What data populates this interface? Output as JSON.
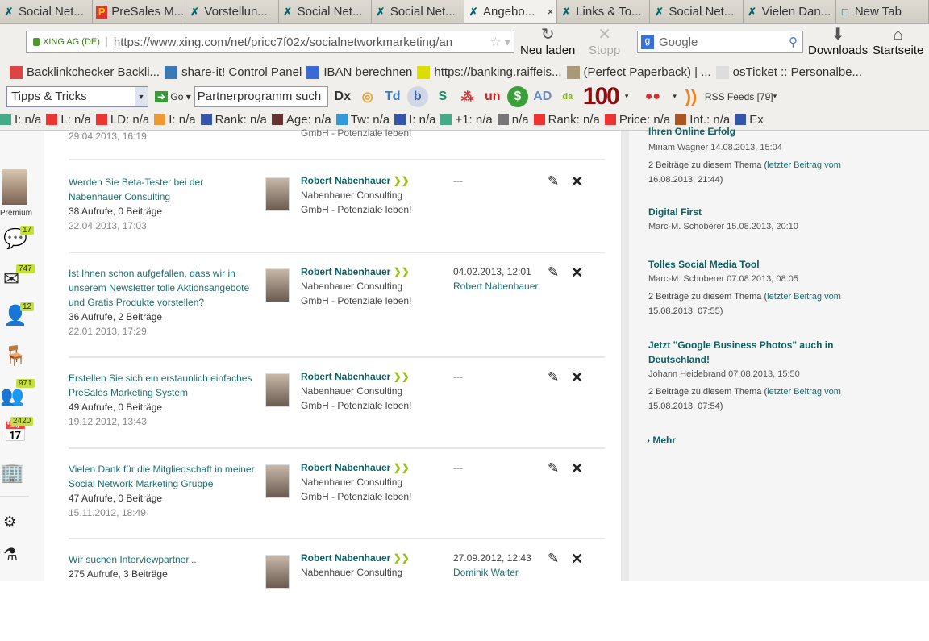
{
  "tabs": [
    {
      "label": "Social Net...",
      "icon": "xing-icon"
    },
    {
      "label": "PreSales M...",
      "icon": "presales-icon"
    },
    {
      "label": "Vorstellun...",
      "icon": "xing-icon"
    },
    {
      "label": "Social Net...",
      "icon": "xing-icon"
    },
    {
      "label": "Social Net...",
      "icon": "xing-icon"
    },
    {
      "label": "Angebo...",
      "icon": "xing-icon",
      "active": true
    },
    {
      "label": "Links & To...",
      "icon": "xing-icon"
    },
    {
      "label": "Social Net...",
      "icon": "xing-icon"
    },
    {
      "label": "Vielen Dan...",
      "icon": "xing-icon"
    },
    {
      "label": "New Tab",
      "icon": "blank-icon"
    }
  ],
  "nav": {
    "site_identity": "XING AG (DE)",
    "url": "https://www.xing.com/net/pricc7f02x/socialnetworkmarketing/an",
    "reload": "Neu laden",
    "stop": "Stopp",
    "search_placeholder": "Google",
    "downloads": "Downloads",
    "home": "Startseite"
  },
  "bookmarks": [
    "Backlinkchecker Backli...",
    "share-it! Control Panel",
    "IBAN berechnen",
    "https://banking.raiffeis...",
    "(Perfect Paperback) | ...",
    "osTicket :: Personalbe..."
  ],
  "toolbar": {
    "dropdown": "Tipps & Tricks",
    "go": "Go",
    "search_value": "Partnerprogramm such",
    "rss": "RSS Feeds [79]",
    "hundred": "100"
  },
  "seo": [
    "I: n/a",
    "L: n/a",
    "LD: n/a",
    "I: n/a",
    "Rank: n/a",
    "Age: n/a",
    "Tw: n/a",
    "I: n/a",
    "+1: n/a",
    "n/a",
    "Rank: n/a",
    "Price: n/a",
    "Int.: n/a",
    "Ex"
  ],
  "sidebar": {
    "premium": "Premium",
    "badges": {
      "messages_star": "17",
      "mail": "747",
      "contacts": "12",
      "groups": "971",
      "events": "2420"
    }
  },
  "main": {
    "top_partial": {
      "date": "29.04.2013, 16:19",
      "company": "GmbH - Potenziale leben!"
    },
    "rows": [
      {
        "title": "Werden Sie Beta-Tester bei der Nabenhauer Consulting",
        "stats": "38 Aufrufe, 0 Beiträge",
        "date": "22.04.2013, 17:03",
        "author": "Robert Nabenhauer",
        "company1": "Nabenhauer Consulting",
        "company2": "GmbH - Potenziale leben!",
        "last_date": "---",
        "last_author": ""
      },
      {
        "title": "Ist Ihnen schon aufgefallen, dass wir in unserem Newsletter tolle Aktionsangebote und Gratis Produkte vorstellen?",
        "stats": "36 Aufrufe, 2 Beiträge",
        "date": "22.01.2013, 17:29",
        "author": "Robert Nabenhauer",
        "company1": "Nabenhauer Consulting",
        "company2": "GmbH - Potenziale leben!",
        "last_date": "04.02.2013, 12:01",
        "last_author": "Robert Nabenhauer"
      },
      {
        "title": "Erstellen Sie sich ein erstaunlich einfaches PreSales Marketing System",
        "stats": "49 Aufrufe, 0 Beiträge",
        "date": "19.12.2012, 13:43",
        "author": "Robert Nabenhauer",
        "company1": "Nabenhauer Consulting",
        "company2": "GmbH - Potenziale leben!",
        "last_date": "---",
        "last_author": ""
      },
      {
        "title": "Vielen Dank für die Mitgliedschaft in meiner Social Network Marketing Gruppe",
        "stats": "47 Aufrufe, 0 Beiträge",
        "date": "15.11.2012, 18:49",
        "author": "Robert Nabenhauer",
        "company1": "Nabenhauer Consulting",
        "company2": "GmbH - Potenziale leben!",
        "last_date": "---",
        "last_author": ""
      },
      {
        "title": "Wir suchen Interviewpartner...",
        "stats": "275 Aufrufe, 3 Beiträge",
        "date": "",
        "author": "Robert Nabenhauer",
        "company1": "Nabenhauer Consulting",
        "company2": "",
        "last_date": "27.09.2012, 12:43",
        "last_author": "Dominik Walter"
      }
    ]
  },
  "right": {
    "partial_title": "Ihren Online Erfolg",
    "items": [
      {
        "title": "",
        "by": "Miriam Wagner 14.08.2013, 15:04",
        "note": "2 Beiträge zu diesem Thema (",
        "note_link": "letzter Beitrag vom",
        "note_date": "16.08.2013, 21:44)"
      },
      {
        "title": "Digital First",
        "by": "Marc-M. Schoberer 15.08.2013, 20:10"
      },
      {
        "title": "Tolles Social Media Tool",
        "by": "Marc-M. Schoberer 07.08.2013, 08:05",
        "note": "2 Beiträge zu diesem Thema (",
        "note_link": "letzter Beitrag vom",
        "note_date": "15.08.2013, 07:55)"
      },
      {
        "title": "Jetzt \"Google Business Photos\" auch in Deutschland!",
        "by": "Johann Heidebrand 07.08.2013, 15:50",
        "note": "2 Beiträge zu diesem Thema (",
        "note_link": "letzter Beitrag vom",
        "note_date": "15.08.2013, 07:54)"
      }
    ],
    "more": "Mehr"
  }
}
